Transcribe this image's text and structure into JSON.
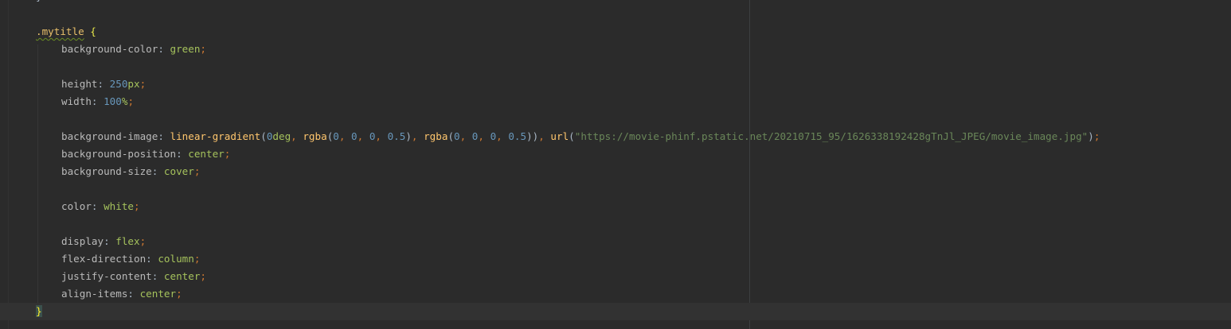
{
  "editor": {
    "prev_brace": "}",
    "selector": ".mytitle",
    "open_brace": "{",
    "close_brace": "}",
    "declarations": {
      "bg_color": {
        "prop": "background-color",
        "value": "green"
      },
      "height": {
        "prop": "height",
        "num": "250",
        "unit": "px"
      },
      "width": {
        "prop": "width",
        "num": "100",
        "unit": "%"
      },
      "bg_image": {
        "prop": "background-image",
        "fn_gradient": "linear-gradient",
        "angle_num": "0",
        "angle_unit": "deg",
        "fn_rgba": "rgba",
        "r": "0",
        "g": "0",
        "b": "0",
        "a": "0.5",
        "fn_rgba2": "rgba",
        "r2": "0",
        "g2": "0",
        "b2": "0",
        "a2": "0.5",
        "fn_url": "url",
        "url": "\"https://movie-phinf.pstatic.net/20210715_95/1626338192428gTnJl_JPEG/movie_image.jpg\""
      },
      "bg_position": {
        "prop": "background-position",
        "value": "center"
      },
      "bg_size": {
        "prop": "background-size",
        "value": "cover"
      },
      "color": {
        "prop": "color",
        "value": "white"
      },
      "display": {
        "prop": "display",
        "value": "flex"
      },
      "flex_direction": {
        "prop": "flex-direction",
        "value": "column"
      },
      "justify_content": {
        "prop": "justify-content",
        "value": "center"
      },
      "align_items": {
        "prop": "align-items",
        "value": "center"
      }
    }
  },
  "colors": {
    "background": "#2b2b2b",
    "property": "#bababa",
    "selector": "#e8bf6a",
    "value": "#a5c25c",
    "number": "#6897bb",
    "function": "#ffc66d",
    "string": "#6a8759",
    "punctuation": "#cc7832",
    "brace": "#e8e84a"
  }
}
